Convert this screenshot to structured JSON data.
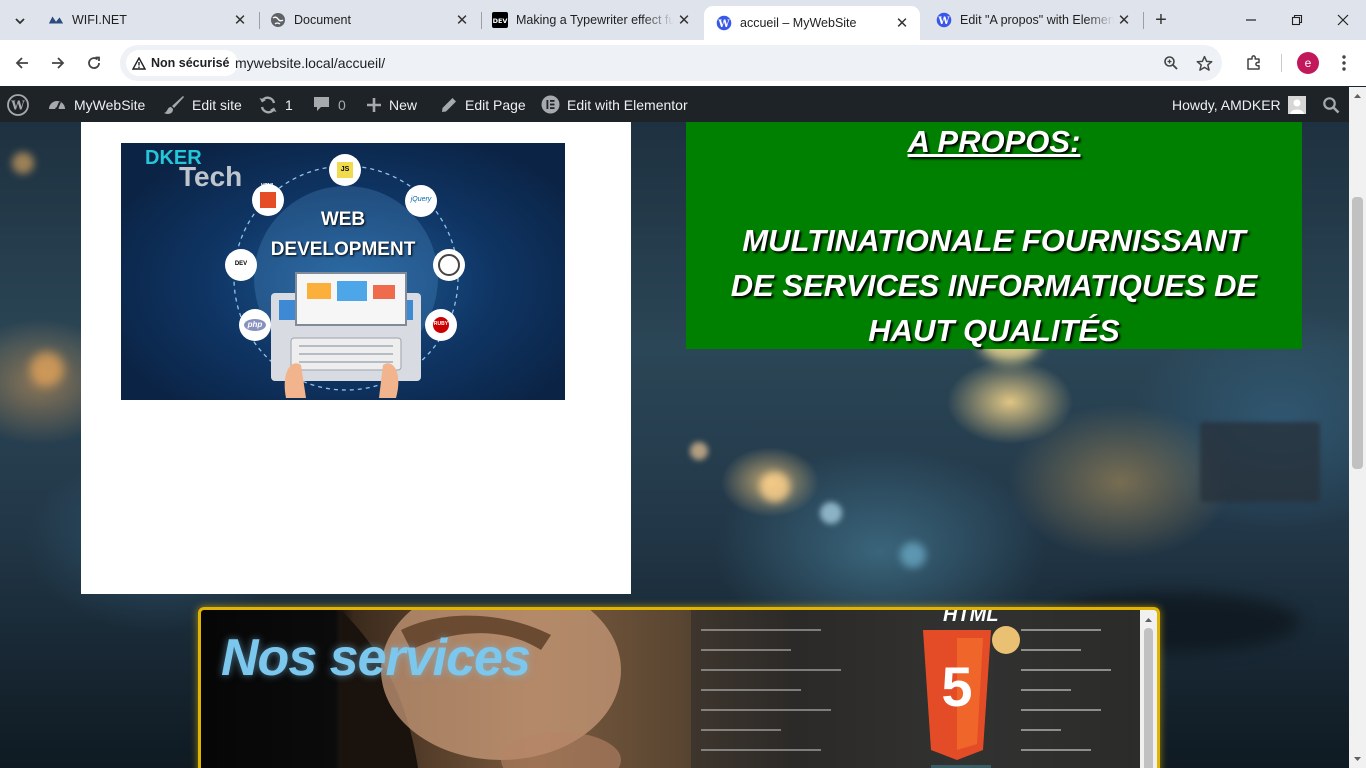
{
  "tabs": [
    {
      "title": "WIFI.NET",
      "icon": "wifinet-icon",
      "active": false
    },
    {
      "title": "Document",
      "icon": "globe-icon",
      "active": false
    },
    {
      "title": "Making a Typewriter effect fu",
      "icon": "dev-icon",
      "active": false
    },
    {
      "title": "accueil – MyWebSite",
      "icon": "wordpress-icon",
      "active": true
    },
    {
      "title": "Edit \"A propos\" with Elemen",
      "icon": "wordpress-icon",
      "active": false
    }
  ],
  "addressbar": {
    "security_label": "Non sécurisé",
    "url": "mywebsite.local/accueil/",
    "profile_initial": "e"
  },
  "adminbar": {
    "site_name": "MyWebSite",
    "edit_site": "Edit site",
    "updates_count": "1",
    "comments_count": "0",
    "new_label": "New",
    "edit_page": "Edit Page",
    "edit_elementor": "Edit with Elementor",
    "howdy": "Howdy, AMDKER"
  },
  "hero_image": {
    "brand_top": "DKER",
    "brand_bottom": "Tech",
    "line1": "WEB",
    "line2": "DEVELOPMENT",
    "badges": [
      "HTML",
      "JS",
      "jQuery",
      "DEV",
      "php",
      "RUBY"
    ]
  },
  "about": {
    "heading": "A PROPOS:",
    "body": "MULTINATIONALE FOURNISSANT DE SERVICES INFORMATIQUES DE HAUT QUALITÉS"
  },
  "services": {
    "title": "Nos services",
    "badge_text": "HTML",
    "badge_number": "5"
  },
  "colors": {
    "about_bg": "#008000",
    "services_border": "#e0b400",
    "services_title": "#7cc7ee",
    "adminbar_bg": "#1d2327"
  }
}
